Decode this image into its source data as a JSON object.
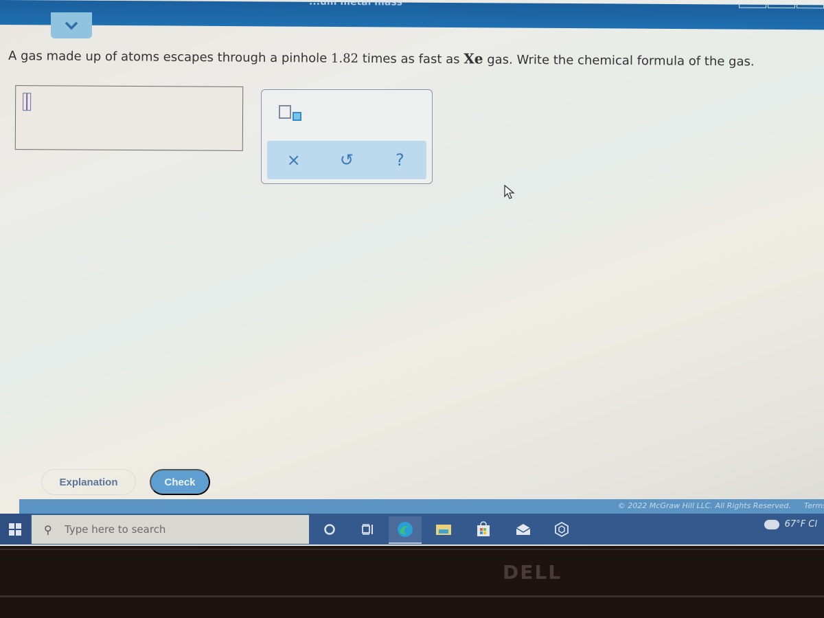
{
  "header": {
    "title_fragment": "...um metal mass"
  },
  "question": {
    "prefix": "A gas made up of atoms escapes through a pinhole ",
    "ratio": "1.82",
    "middle": " times as fast as ",
    "reference_gas": "Xe",
    "suffix": " gas. Write the chemical formula of the gas."
  },
  "answer": {
    "value": ""
  },
  "palette": {
    "subscript_tool": "subscript-tool",
    "clear_label": "×",
    "undo_label": "↺",
    "help_label": "?"
  },
  "buttons": {
    "explanation": "Explanation",
    "check": "Check"
  },
  "footer": {
    "copyright": "© 2022 McGraw Hill LLC. All Rights Reserved.",
    "terms": "Terms"
  },
  "taskbar": {
    "search_placeholder": "Type here to search",
    "icons": [
      "cortana-icon",
      "task-view-icon",
      "edge-icon",
      "file-explorer-icon",
      "store-icon",
      "mail-icon",
      "app-icon"
    ],
    "weather": "67°F  Cl"
  },
  "bezel": {
    "brand": "DELL"
  }
}
